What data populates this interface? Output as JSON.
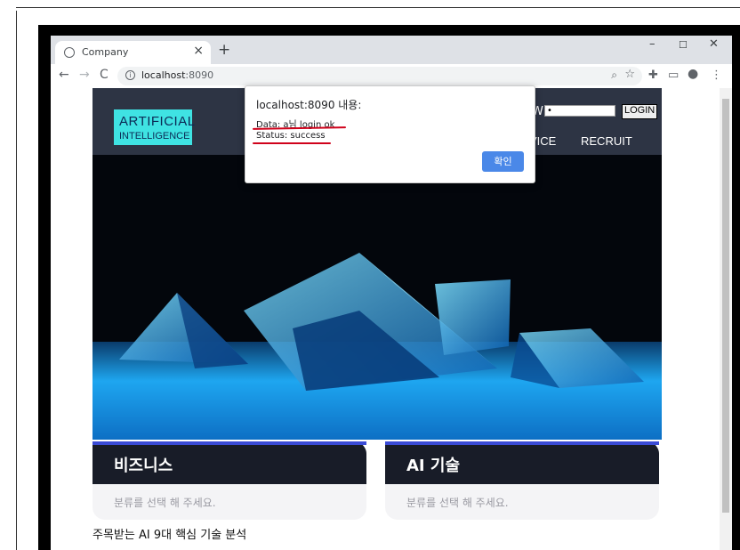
{
  "browser": {
    "tab_title": "Company",
    "new_tab_icon": "+",
    "url_host": "localhost",
    "url_port": ":8090",
    "window_controls": {
      "minimize": "–",
      "maximize": "☐",
      "close": "✕"
    }
  },
  "site": {
    "logo_line1": "ARTIFICIAL",
    "logo_line2": "INTELLIGENCE",
    "pw_label": "W",
    "pw_value": "•",
    "login_label": "LOGIN",
    "nav": [
      "VICE",
      "RECRUIT"
    ],
    "cards": [
      {
        "title": "비즈니스",
        "placeholder": "분류를 선택 해 주세요."
      },
      {
        "title": "AI 기술",
        "placeholder": "분류를 선택 해 주세요."
      }
    ],
    "caption": "주목받는 AI 9대 핵심 기술 분석"
  },
  "dialog": {
    "title": "localhost:8090 내용:",
    "line1": "Data: a님 login ok",
    "line2": "Status: success",
    "ok_label": "확인"
  },
  "colors": {
    "header_bg": "#2d3444",
    "logo_bg": "#3fe3e3",
    "annotation_red": "#d0021b",
    "ok_button": "#4a88e8"
  }
}
